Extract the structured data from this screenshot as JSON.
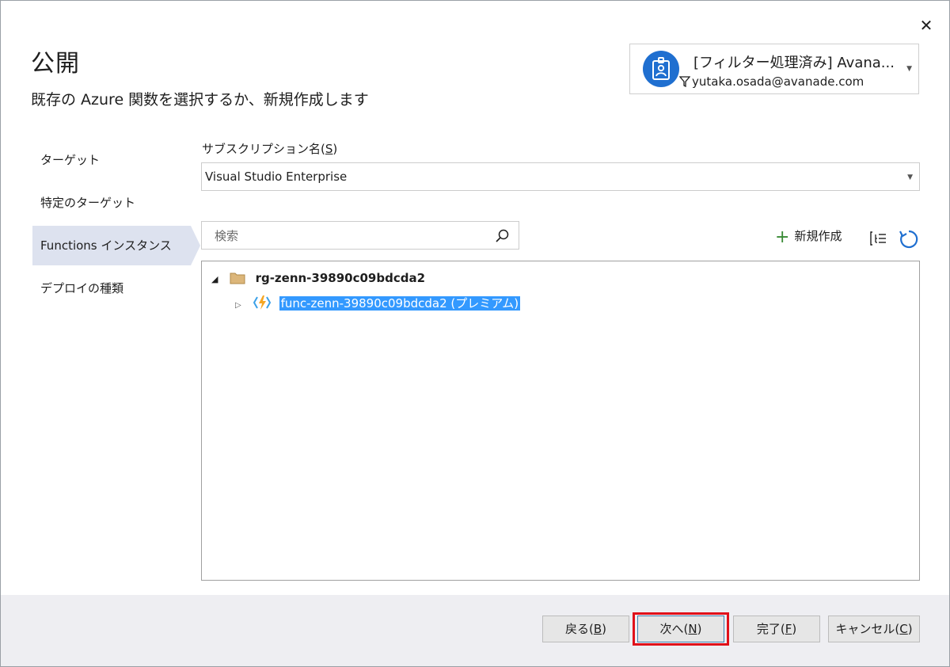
{
  "dialog": {
    "title": "公開",
    "subtitle": "既存の Azure 関数を選択するか、新規作成します",
    "close_symbol": "✕"
  },
  "account": {
    "name": "[フィルター処理済み] Avana...",
    "email": "yutaka.osada@avanade.com",
    "icon": "badge-icon",
    "filter_icon": "filter-icon"
  },
  "nav": {
    "items": [
      {
        "label": "ターゲット",
        "active": false
      },
      {
        "label": "特定のターゲット",
        "active": false
      },
      {
        "label": "Functions インスタンス",
        "active": true
      },
      {
        "label": "デプロイの種類",
        "active": false
      }
    ]
  },
  "subscription": {
    "label_prefix": "サブスクリプション名(",
    "label_key": "S",
    "label_suffix": ")",
    "value": "Visual Studio Enterprise"
  },
  "search": {
    "placeholder": "検索",
    "value": ""
  },
  "toolbar": {
    "new_label": "新規作成",
    "plus_symbol": "+"
  },
  "tree": {
    "groups": [
      {
        "name": "rg-zenn-39890c09bdcda2",
        "expanded_symbol": "◢",
        "items": [
          {
            "name": "func-zenn-39890c09bdcda2 (プレミアム)",
            "selected": true,
            "collapsed_symbol": "▷"
          }
        ]
      }
    ]
  },
  "buttons": {
    "back": {
      "text": "戻る",
      "key": "B"
    },
    "next": {
      "text": "次へ",
      "key": "N"
    },
    "finish": {
      "text": "完了",
      "key": "F"
    },
    "cancel": {
      "text": "キャンセル",
      "key": "C"
    }
  },
  "colors": {
    "accent": "#1f6fd0",
    "selection": "#3399ff",
    "nav_active": "#dde2ef",
    "highlight": "#e0101a",
    "plus": "#388a34"
  }
}
